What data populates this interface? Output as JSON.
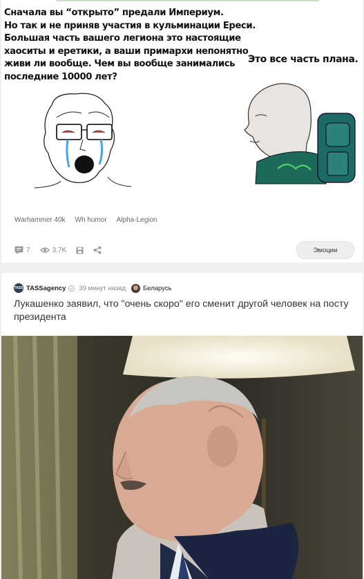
{
  "post1": {
    "meme": {
      "left_text_lines": [
        "Сначала вы “открыто” предали Империум.",
        "Но так и не приняв участия в кульминации Ереси.",
        "Большая часть вашего легиона это настоящие",
        "хаоситы и еретики, а ваши примархи непонятно",
        "живи ли вообще. Чем вы вообще занимались",
        "последние 10000 лет?"
      ],
      "right_text": "Это все часть плана."
    },
    "tags": [
      "Warhammer 40k",
      "Wh humor",
      "Alpha-Legion"
    ],
    "stats": {
      "comments": "7",
      "views": "3.7K"
    },
    "emotions_label": "Эмоции"
  },
  "post2": {
    "author": "TASSagency",
    "logo_text": "TASS",
    "time": "39 минут назад",
    "community": "Беларусь",
    "title": "Лукашенко заявил, что \"очень скоро\" его сменит другой человек на посту президента"
  }
}
